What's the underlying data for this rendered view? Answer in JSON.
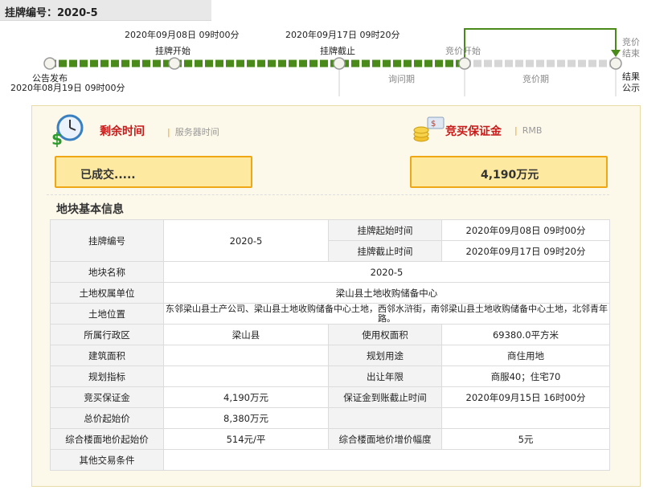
{
  "header": {
    "code_label": "挂牌编号：2020-5"
  },
  "timeline": {
    "announce": {
      "label": "公告发布",
      "time": "2020年08月19日 09时00分"
    },
    "listing_start": {
      "label": "挂牌开始",
      "time": "2020年09月08日 09时00分"
    },
    "listing_end": {
      "label": "挂牌截止",
      "time": "2020年09月17日 09时20分"
    },
    "bid_start": {
      "label": "竞价开始"
    },
    "bid_end": {
      "label_line1": "竞价",
      "label_line2": "结束"
    },
    "result": {
      "label_line1": "结果",
      "label_line2": "公示"
    },
    "inquiry_period": "询问期",
    "bid_period": "竞价期"
  },
  "status_panel": {
    "remaining_title": "剩余时间",
    "server_time_label": "服务器时间",
    "remaining_value": "已成交.....",
    "deposit_title": "竞买保证金",
    "currency_label": "RMB",
    "deposit_value": "4,190万元",
    "icons": [
      "clock-money-icon",
      "coins-icon"
    ]
  },
  "section_title": "地块基本信息",
  "table": {
    "r1": {
      "l1": "挂牌编号",
      "v1": "2020-5",
      "l2": "挂牌起始时间",
      "v2": "2020年09月08日 09时00分"
    },
    "r2": {
      "l2": "挂牌截止时间",
      "v2": "2020年09月17日 09时20分"
    },
    "r3": {
      "l1": "地块名称",
      "v1": "2020-5"
    },
    "r4": {
      "l1": "土地权属单位",
      "v1": "梁山县土地收购储备中心"
    },
    "r5": {
      "l1": "土地位置",
      "v1": "东邻梁山县土产公司、梁山县土地收购储备中心土地，西邻水浒街，南邻梁山县土地收购储备中心土地，北邻青年路。"
    },
    "r6": {
      "l1": "所属行政区",
      "v1": "梁山县",
      "l2": "使用权面积",
      "v2": "69380.0平方米"
    },
    "r7": {
      "l1": "建筑面积",
      "v1": "",
      "l2": "规划用途",
      "v2": "商住用地"
    },
    "r8": {
      "l1": "规划指标",
      "v1": "",
      "l2": "出让年限",
      "v2": "商服40；住宅70"
    },
    "r9": {
      "l1": "竞买保证金",
      "v1": "4,190万元",
      "l2": "保证金到账截止时间",
      "v2": "2020年09月15日 16时00分"
    },
    "r10": {
      "l1": "总价起始价",
      "v1": "8,380万元",
      "l2": "",
      "v2": ""
    },
    "r11": {
      "l1": "综合楼面地价起始价",
      "v1": "514元/平",
      "l2": "综合楼面地价增价幅度",
      "v2": "5元"
    },
    "r12": {
      "l1": "其他交易条件",
      "v1": ""
    }
  },
  "colors": {
    "progress_done": "#4a8a1a",
    "progress_pending": "#d6d6d6",
    "accent_red": "#c91a1a",
    "box_border": "#f0a716",
    "box_fill": "#fde9a0",
    "panel_bg": "#fdf9ea"
  }
}
